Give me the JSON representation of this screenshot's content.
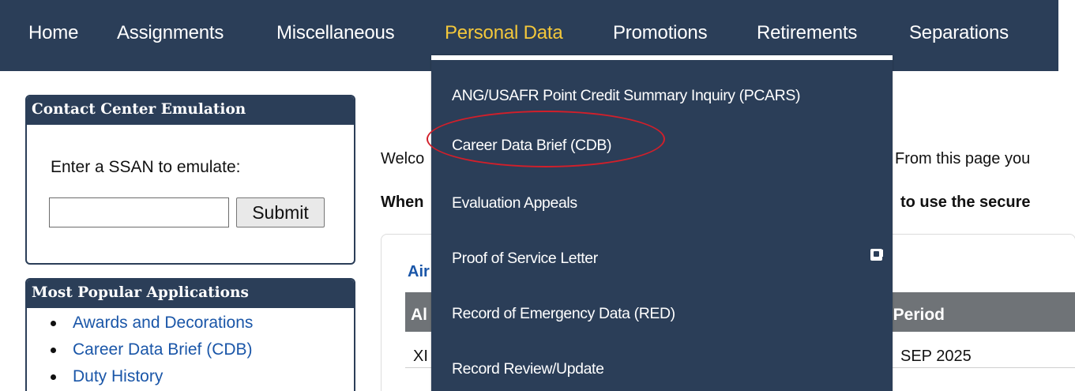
{
  "nav": {
    "items": [
      {
        "label": "Home"
      },
      {
        "label": "Assignments"
      },
      {
        "label": "Miscellaneous"
      },
      {
        "label": "Personal Data",
        "active": true
      },
      {
        "label": "Promotions"
      },
      {
        "label": "Retirements"
      },
      {
        "label": "Separations"
      }
    ]
  },
  "dropdown": {
    "items": [
      {
        "label": "ANG/USAFR Point Credit Summary Inquiry (PCARS)"
      },
      {
        "label": "Career Data Brief (CDB)",
        "highlighted": true
      },
      {
        "label": "Evaluation Appeals",
        "icon": "external-link-icon"
      },
      {
        "label": "Proof of Service Letter"
      },
      {
        "label": "Record of Emergency Data (RED)"
      },
      {
        "label": "Record Review/Update"
      }
    ]
  },
  "contact_panel": {
    "title": "Contact Center Emulation",
    "prompt": "Enter a SSAN to emulate:",
    "input_value": "",
    "submit_label": "Submit"
  },
  "popular_panel": {
    "title": "Most Popular Applications",
    "items": [
      {
        "label": "Awards and Decorations"
      },
      {
        "label": "Career Data Brief (CDB)"
      },
      {
        "label": "Duty History"
      }
    ]
  },
  "main": {
    "welcome_left": "Welco",
    "welcome_right": "From this page you",
    "when_left": "When",
    "when_right": "to use the secure",
    "card_title": "Air",
    "table": {
      "header_left": "Al",
      "header_right": "n Period",
      "row_left": "XI",
      "row_right": "SEP 2025"
    }
  },
  "colors": {
    "nav_bg": "#2b3e58",
    "active_nav": "#f3c73b",
    "link": "#1a56a8",
    "highlight_ring": "#d21f2a",
    "table_header": "#6f7377"
  }
}
